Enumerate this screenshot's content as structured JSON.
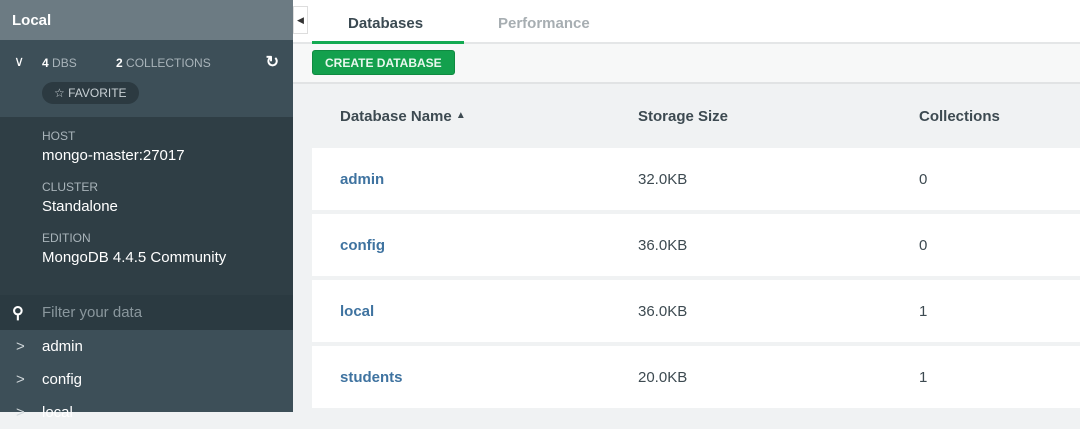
{
  "sidebar": {
    "title": "Local",
    "dbs_count": "4",
    "dbs_label": "DBS",
    "collections_count": "2",
    "collections_label": "COLLECTIONS",
    "favorite_label": "FAVORITE",
    "host_label": "HOST",
    "host": "mongo-master:27017",
    "cluster_label": "CLUSTER",
    "cluster": "Standalone",
    "edition_label": "EDITION",
    "edition": "MongoDB 4.4.5 Community",
    "filter_placeholder": "Filter your data",
    "databases": [
      "admin",
      "config",
      "local"
    ]
  },
  "tabs": [
    {
      "label": "Databases"
    },
    {
      "label": "Performance"
    }
  ],
  "toolbar": {
    "create_label": "CREATE DATABASE"
  },
  "table": {
    "headers": [
      "Database Name",
      "Storage Size",
      "Collections"
    ],
    "sort_indicator": "▲",
    "rows": [
      [
        "admin",
        "32.0KB",
        "0"
      ],
      [
        "config",
        "36.0KB",
        "0"
      ],
      [
        "local",
        "36.0KB",
        "1"
      ],
      [
        "students",
        "20.0KB",
        "1"
      ]
    ]
  }
}
